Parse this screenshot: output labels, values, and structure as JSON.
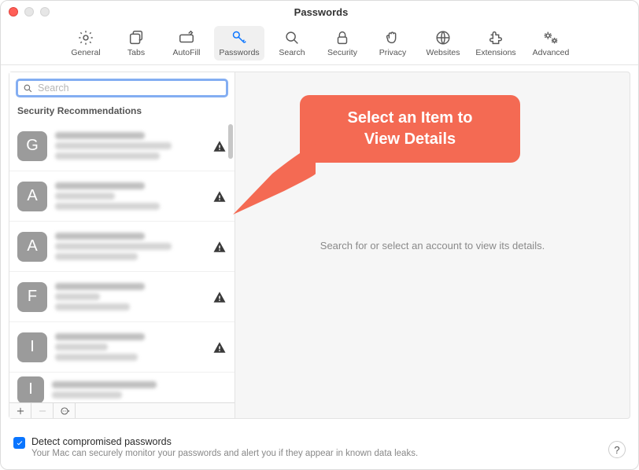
{
  "window": {
    "title": "Passwords"
  },
  "toolbar": {
    "items": [
      {
        "label": "General"
      },
      {
        "label": "Tabs"
      },
      {
        "label": "AutoFill"
      },
      {
        "label": "Passwords"
      },
      {
        "label": "Search"
      },
      {
        "label": "Security"
      },
      {
        "label": "Privacy"
      },
      {
        "label": "Websites"
      },
      {
        "label": "Extensions"
      },
      {
        "label": "Advanced"
      }
    ],
    "selected_index": 3
  },
  "sidebar": {
    "search_placeholder": "Search",
    "section_header": "Security Recommendations",
    "items": [
      {
        "letter": "G"
      },
      {
        "letter": "A"
      },
      {
        "letter": "A"
      },
      {
        "letter": "F"
      },
      {
        "letter": "I"
      },
      {
        "letter": "I"
      }
    ]
  },
  "detail": {
    "placeholder": "Search for or select an account to view its details."
  },
  "callout": {
    "line1": "Select an Item to",
    "line2": "View Details"
  },
  "footer": {
    "checkbox_checked": true,
    "title": "Detect compromised passwords",
    "subtitle": "Your Mac can securely monitor your passwords and alert you if they appear in known data leaks."
  },
  "help_label": "?"
}
